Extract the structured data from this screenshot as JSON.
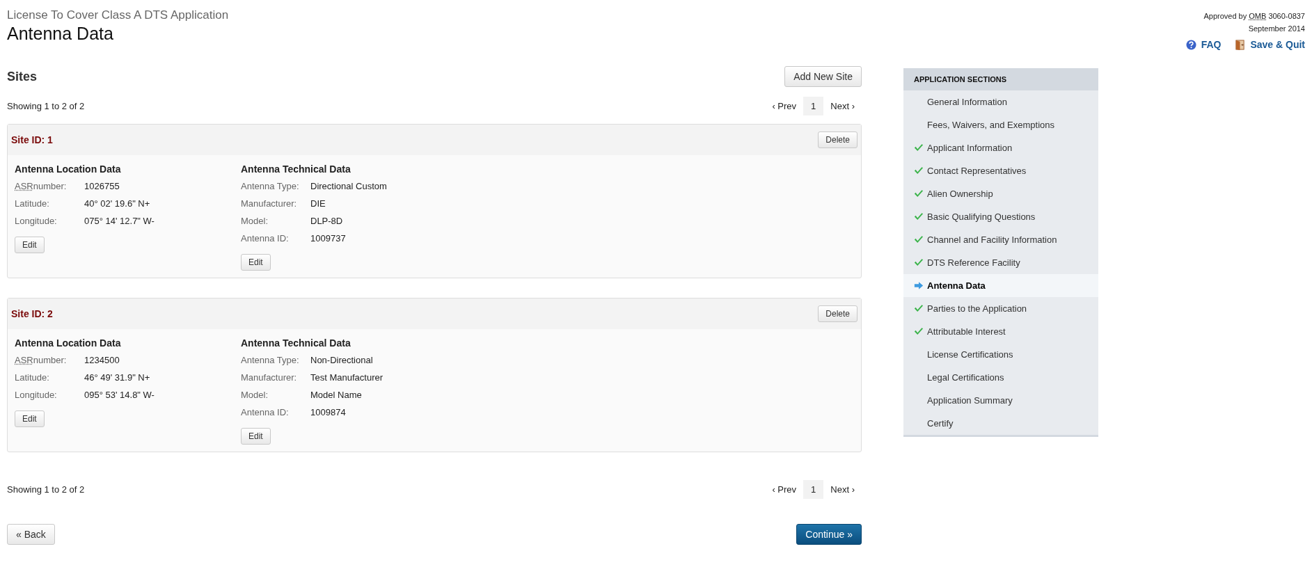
{
  "header": {
    "subtitle": "License To Cover Class A DTS Application",
    "title": "Antenna Data",
    "approval": {
      "prefix": "Approved by",
      "abbr": "OMB",
      "number": "3060-0837",
      "date": "September 2014"
    },
    "links": [
      {
        "kind": "help",
        "label": "FAQ"
      },
      {
        "kind": "exit",
        "label": "Save & Quit"
      }
    ]
  },
  "sites": {
    "heading": "Sites",
    "add_button": "Add New Site",
    "summary_top": "Showing 1 to 2 of 2",
    "pagination_top": {
      "prev": "‹ Prev",
      "pages": [
        {
          "label": "1",
          "selected": true
        }
      ],
      "next": "Next ›"
    },
    "items": [
      {
        "title": "Site ID: 1",
        "delete": "Delete",
        "location": {
          "heading": "Antenna Location Data",
          "fields": [
            {
              "abbr": "ASR",
              "label": "number:",
              "value": "1026755"
            },
            {
              "label": "Latitude:",
              "value": "40° 02' 19.6\" N+"
            },
            {
              "label": "Longitude:",
              "value": "075° 14' 12.7\" W-"
            }
          ],
          "edit": "Edit"
        },
        "technical": {
          "heading": "Antenna Technical Data",
          "fields": [
            {
              "label": "Antenna Type:",
              "value": "Directional Custom"
            },
            {
              "label": "Manufacturer:",
              "value": "DIE"
            },
            {
              "label": "Model:",
              "value": "DLP-8D"
            },
            {
              "label": "Antenna ID:",
              "value": "1009737"
            }
          ],
          "edit": "Edit"
        }
      },
      {
        "title": "Site ID: 2",
        "delete": "Delete",
        "location": {
          "heading": "Antenna Location Data",
          "fields": [
            {
              "abbr": "ASR",
              "label": "number:",
              "value": "1234500"
            },
            {
              "label": "Latitude:",
              "value": "46° 49' 31.9\" N+"
            },
            {
              "label": "Longitude:",
              "value": "095° 53' 14.8\" W-"
            }
          ],
          "edit": "Edit"
        },
        "technical": {
          "heading": "Antenna Technical Data",
          "fields": [
            {
              "label": "Antenna Type:",
              "value": "Non-Directional"
            },
            {
              "label": "Manufacturer:",
              "value": "Test Manufacturer"
            },
            {
              "label": "Model:",
              "value": "Model Name"
            },
            {
              "label": "Antenna ID:",
              "value": "1009874"
            }
          ],
          "edit": "Edit"
        }
      }
    ],
    "summary_bottom": "Showing 1 to 2 of 2",
    "pagination_bottom": {
      "prev": "‹ Prev",
      "pages": [
        {
          "label": "1",
          "selected": true
        }
      ],
      "next": "Next ›"
    }
  },
  "footer": {
    "back": "« Back",
    "continue": "Continue »"
  },
  "sidebar": {
    "heading": "APPLICATION SECTIONS",
    "items": [
      {
        "label": "General Information",
        "kind": "plain",
        "selected": false
      },
      {
        "label": "Fees, Waivers, and Exemptions",
        "kind": "plain",
        "selected": false
      },
      {
        "label": "Applicant Information",
        "kind": "checked",
        "selected": false
      },
      {
        "label": "Contact Representatives",
        "kind": "checked",
        "selected": false
      },
      {
        "label": "Alien Ownership",
        "kind": "checked",
        "selected": false
      },
      {
        "label": "Basic Qualifying Questions",
        "kind": "checked",
        "selected": false
      },
      {
        "label": "Channel and Facility Information",
        "kind": "checked",
        "selected": false
      },
      {
        "label": "DTS Reference Facility",
        "kind": "checked",
        "selected": false
      },
      {
        "label": "Antenna Data",
        "kind": "arrow",
        "selected": true
      },
      {
        "label": "Parties to the Application",
        "kind": "checked",
        "selected": false
      },
      {
        "label": "Attributable Interest",
        "kind": "checked",
        "selected": false
      },
      {
        "label": "License Certifications",
        "kind": "plain",
        "selected": false
      },
      {
        "label": "Legal Certifications",
        "kind": "plain",
        "selected": false
      },
      {
        "label": "Application Summary",
        "kind": "plain",
        "selected": false
      },
      {
        "label": "Certify",
        "kind": "plain",
        "selected": false
      }
    ]
  }
}
